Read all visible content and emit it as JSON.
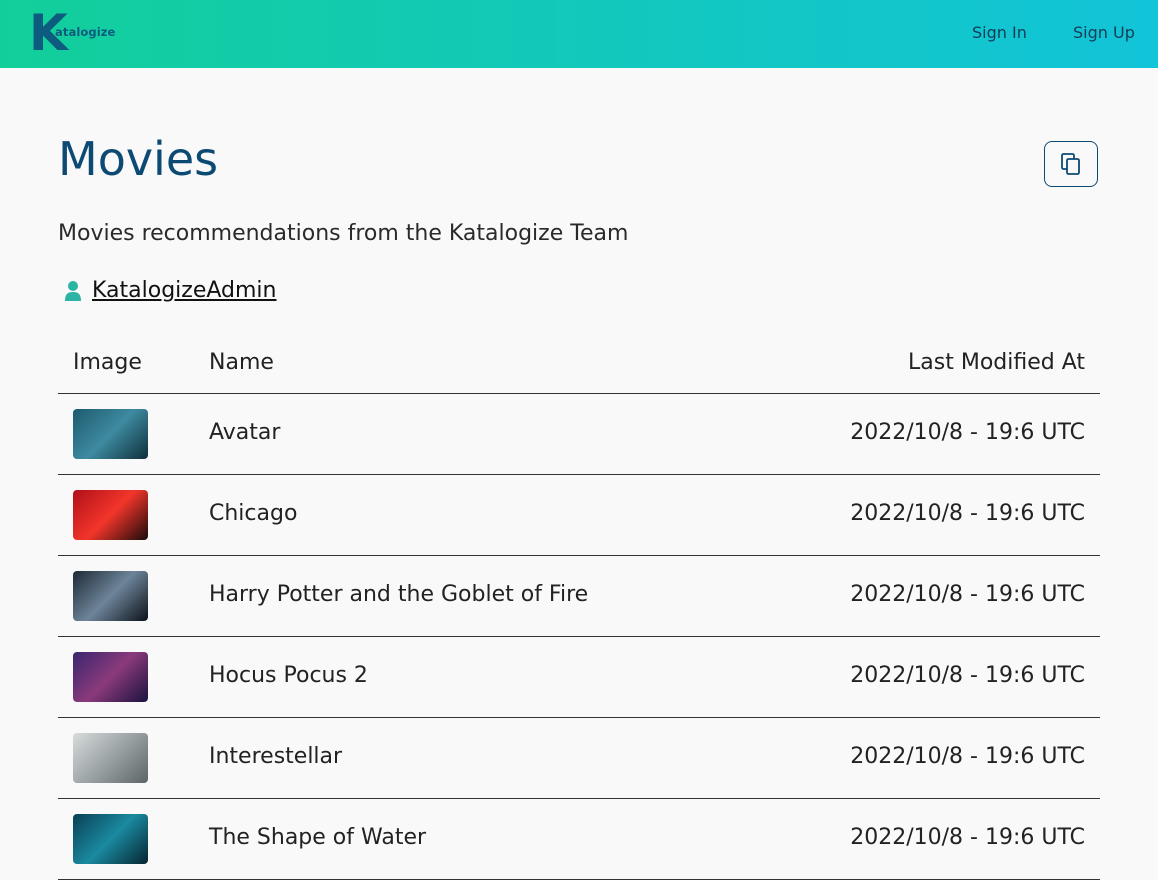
{
  "brand": {
    "logo_letter": "K",
    "logo_text": "atalogize"
  },
  "nav": {
    "sign_in": "Sign In",
    "sign_up": "Sign Up"
  },
  "page": {
    "title": "Movies",
    "description": "Movies recommendations from the Katalogize Team",
    "author": "KatalogizeAdmin",
    "copy_icon": "copy-icon"
  },
  "table": {
    "headers": {
      "image": "Image",
      "name": "Name",
      "last_modified": "Last Modified At"
    },
    "rows": [
      {
        "name": "Avatar",
        "modified": "2022/10/8 - 19:6 UTC",
        "thumb_colors": [
          "#1d5a6e",
          "#3e8aa0",
          "#0e2f3a"
        ]
      },
      {
        "name": "Chicago",
        "modified": "2022/10/8 - 19:6 UTC",
        "thumb_colors": [
          "#b0101a",
          "#f2352a",
          "#1a0a0a"
        ]
      },
      {
        "name": "Harry Potter and the Goblet of Fire",
        "modified": "2022/10/8 - 19:6 UTC",
        "thumb_colors": [
          "#1e2a36",
          "#6d8499",
          "#0b1219"
        ]
      },
      {
        "name": "Hocus Pocus 2",
        "modified": "2022/10/8 - 19:6 UTC",
        "thumb_colors": [
          "#3a2670",
          "#8a3a7a",
          "#1a1240"
        ]
      },
      {
        "name": "Interestellar",
        "modified": "2022/10/8 - 19:6 UTC",
        "thumb_colors": [
          "#d8dcdc",
          "#9aa2a4",
          "#5c6466"
        ]
      },
      {
        "name": "The Shape of Water",
        "modified": "2022/10/8 - 19:6 UTC",
        "thumb_colors": [
          "#0a3f55",
          "#1a8aa0",
          "#062430"
        ]
      }
    ]
  }
}
